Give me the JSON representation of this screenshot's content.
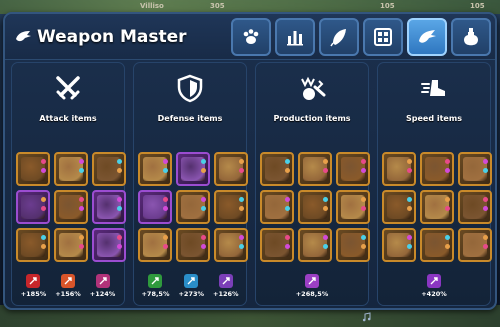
{
  "map": {
    "labels": [
      "Villiso",
      "305",
      "105",
      "105"
    ]
  },
  "window": {
    "title": "Weapon Master"
  },
  "tabs": [
    {
      "icon": "paw-icon",
      "active": false
    },
    {
      "icon": "bar-chart-icon",
      "active": false
    },
    {
      "icon": "feather-icon",
      "active": false
    },
    {
      "icon": "map-grid-icon",
      "active": false
    },
    {
      "icon": "pet-icon",
      "active": true
    },
    {
      "icon": "potion-icon",
      "active": false
    }
  ],
  "cards": [
    {
      "id": "attack",
      "title": "Attack items",
      "icon": "crossed-swords-icon",
      "slots": [
        "gold",
        "gold",
        "gold",
        "purple",
        "gold",
        "purple",
        "gold",
        "gold",
        "purple"
      ],
      "bonuses": [
        {
          "icon": "sword-bonus-icon",
          "value": "+185%",
          "color": "#c7262b"
        },
        {
          "icon": "axe-bonus-icon",
          "value": "+156%",
          "color": "#d9552a"
        },
        {
          "icon": "bow-bonus-icon",
          "value": "+124%",
          "color": "#b1337a"
        }
      ]
    },
    {
      "id": "defense",
      "title": "Defense items",
      "icon": "shield-icon",
      "slots": [
        "gold",
        "purple",
        "gold",
        "purple",
        "gold",
        "gold",
        "gold",
        "gold",
        "gold"
      ],
      "bonuses": [
        {
          "icon": "infantry-def-icon",
          "value": "+78,5%",
          "color": "#2f9a3d"
        },
        {
          "icon": "shield-def-icon",
          "value": "+273%",
          "color": "#2a8ec9"
        },
        {
          "icon": "cavalry-def-icon",
          "value": "+126%",
          "color": "#7b3fb8"
        }
      ]
    },
    {
      "id": "production",
      "title": "Production items",
      "icon": "production-icon",
      "slots": [
        "gold",
        "gold",
        "gold",
        "gold",
        "gold",
        "gold",
        "gold",
        "gold",
        "gold"
      ],
      "bonuses": [
        {
          "icon": "gift-bonus-icon",
          "value": "+268,5%",
          "color": "#9b3fc4"
        }
      ]
    },
    {
      "id": "speed",
      "title": "Speed items",
      "icon": "speed-boot-icon",
      "slots": [
        "gold",
        "gold",
        "gold",
        "gold",
        "gold",
        "gold",
        "gold",
        "gold",
        "gold"
      ],
      "bonuses": [
        {
          "icon": "speed-bonus-icon",
          "value": "+420%",
          "color": "#8a36c2"
        }
      ]
    }
  ],
  "colors": {
    "gold_border": "#c98a2a",
    "purple_border": "#9b4dd1",
    "active_tab": "#4a96d8"
  }
}
